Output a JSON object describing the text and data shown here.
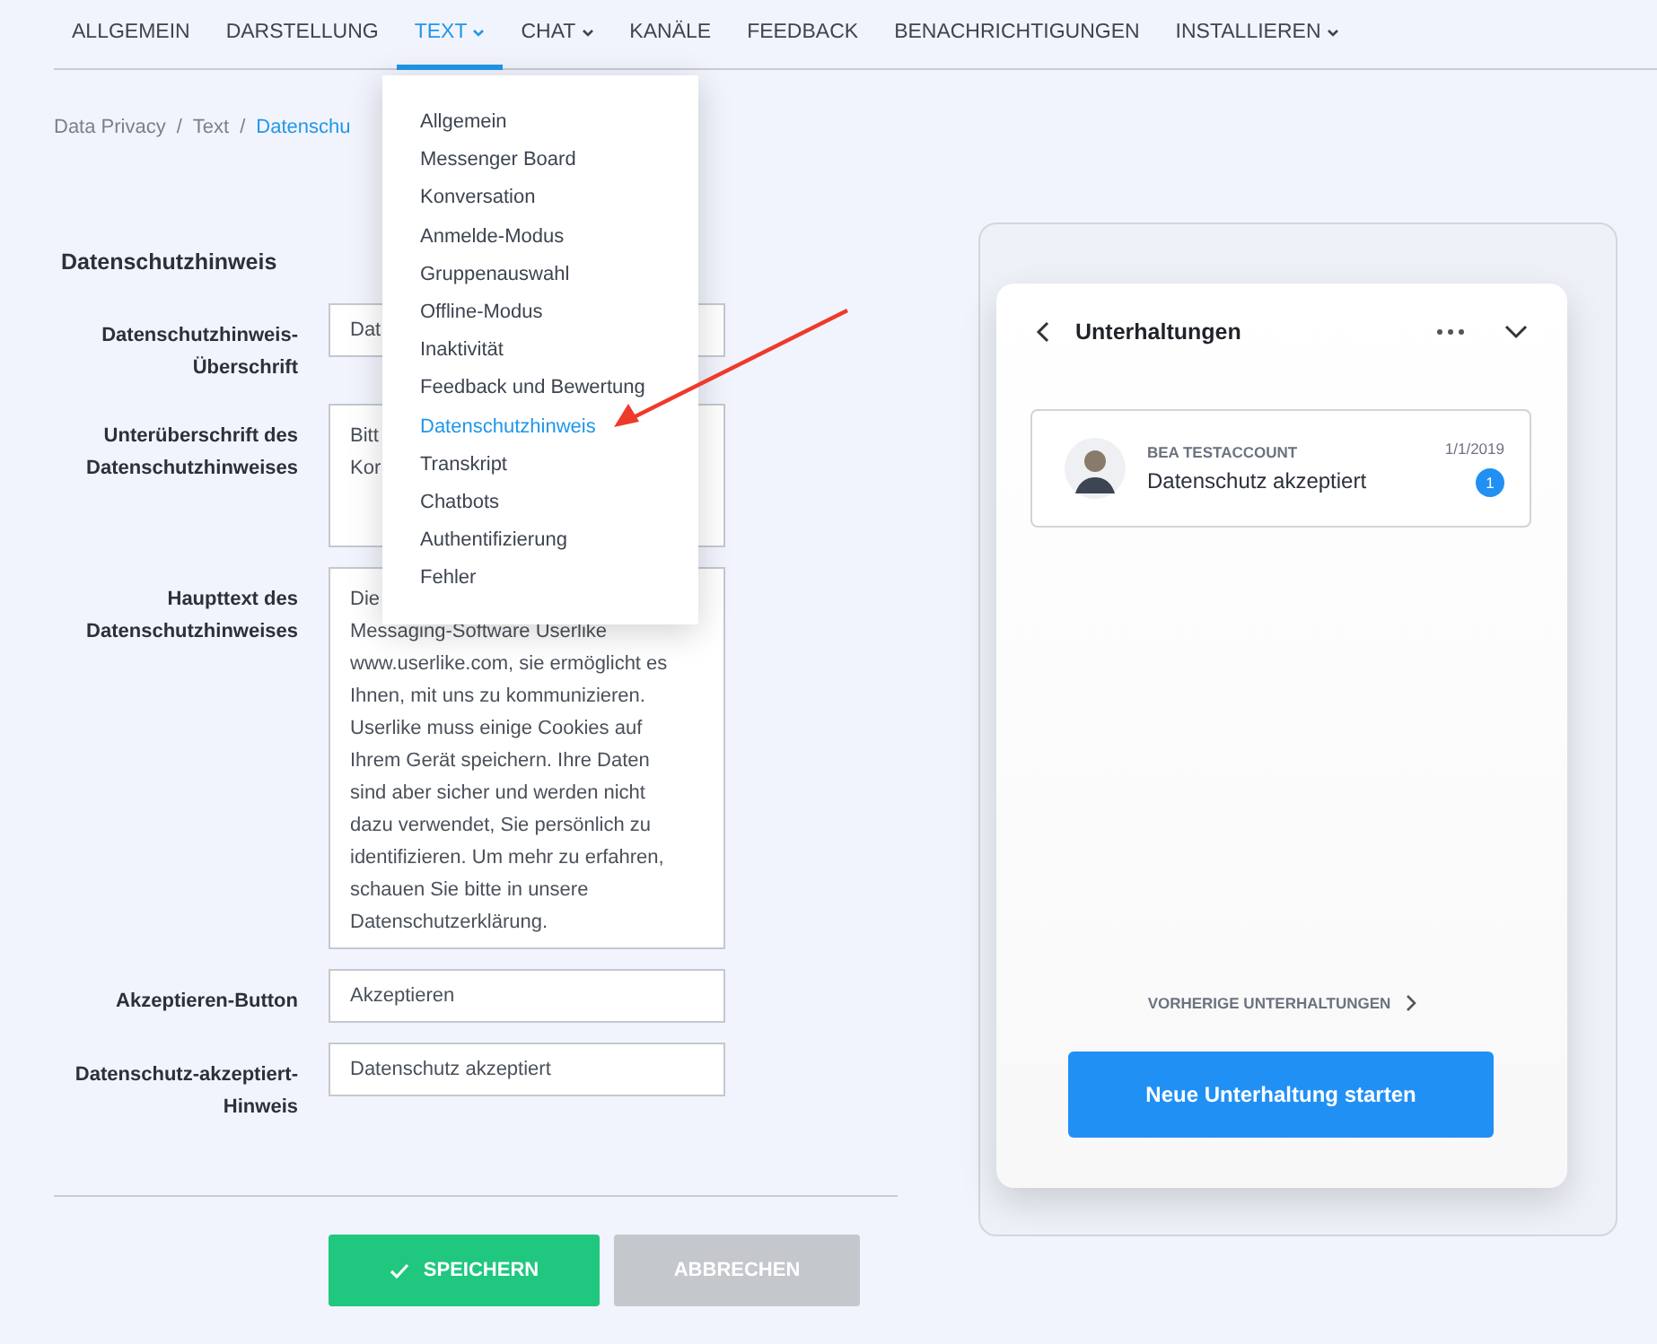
{
  "nav": {
    "items": [
      {
        "label": "ALLGEMEIN",
        "selected": false,
        "dropdown": false
      },
      {
        "label": "DARSTELLUNG",
        "selected": false,
        "dropdown": false
      },
      {
        "label": "TEXT",
        "selected": true,
        "dropdown": true
      },
      {
        "label": "CHAT",
        "selected": false,
        "dropdown": true
      },
      {
        "label": "KANÄLE",
        "selected": false,
        "dropdown": false
      },
      {
        "label": "FEEDBACK",
        "selected": false,
        "dropdown": false
      },
      {
        "label": "BENACHRICHTIGUNGEN",
        "selected": false,
        "dropdown": false
      },
      {
        "label": "INSTALLIEREN",
        "selected": false,
        "dropdown": true
      }
    ]
  },
  "breadcrumb": {
    "items": [
      "Data Privacy",
      "Text",
      "Datenschu"
    ],
    "separators": [
      "/",
      "/"
    ]
  },
  "dropdown_menu": {
    "items": [
      {
        "label": "Allgemein",
        "selected": false
      },
      {
        "label": "Messenger Board",
        "selected": false
      },
      {
        "label": "Konversation",
        "selected": false
      },
      {
        "label": "Anmelde-Modus",
        "selected": false
      },
      {
        "label": "Gruppenauswahl",
        "selected": false
      },
      {
        "label": "Offline-Modus",
        "selected": false
      },
      {
        "label": "Inaktivität",
        "selected": false
      },
      {
        "label": "Feedback und Bewertung",
        "selected": false
      },
      {
        "label": "Datenschutzhinweis",
        "selected": true
      },
      {
        "label": "Transkript",
        "selected": false
      },
      {
        "label": "Chatbots",
        "selected": false
      },
      {
        "label": "Authentifizierung",
        "selected": false
      },
      {
        "label": "Fehler",
        "selected": false
      }
    ]
  },
  "form": {
    "title": "Datenschutzhinweis",
    "fields": [
      {
        "label": [
          "Datenschutzhinweis-",
          "Überschrift"
        ],
        "kind": "single",
        "lines": [
          "Dat"
        ]
      },
      {
        "label": [
          "Unterüberschrift des",
          "Datenschutzhinweises"
        ],
        "kind": "medium",
        "lines": [
          "Bitt",
          "Kor"
        ]
      },
      {
        "label": [
          "Haupttext des",
          "Datenschutzhinweises"
        ],
        "kind": "large",
        "lines": [
          "Die",
          "Messaging-Software Userlike",
          "www.userlike.com, sie ermöglicht es",
          "Ihnen, mit uns zu kommunizieren.",
          "Userlike muss einige Cookies auf",
          "Ihrem Gerät speichern. Ihre Daten",
          "sind aber sicher und werden nicht",
          "dazu verwendet, Sie persönlich zu",
          "identifizieren. Um mehr zu erfahren,",
          "schauen Sie bitte in unsere",
          "Datenschutzerklärung."
        ]
      },
      {
        "label": [
          "Akzeptieren-Button"
        ],
        "kind": "single",
        "lines": [
          "Akzeptieren"
        ]
      },
      {
        "label": [
          "Datenschutz-akzeptiert-",
          "Hinweis"
        ],
        "kind": "single",
        "lines": [
          "Datenschutz akzeptiert"
        ]
      }
    ]
  },
  "buttons": [
    {
      "label": "SPEICHERN",
      "disabled": false
    },
    {
      "label": "ABBRECHEN",
      "disabled": true
    }
  ],
  "preview": {
    "title": "Unterhaltungen",
    "conversation": {
      "name": "BEA TESTACCOUNT",
      "date": "1/1/2019",
      "message": "Datenschutz akzeptiert",
      "unread": "1"
    },
    "previous_link": "VORHERIGE UNTERHALTUNGEN",
    "start_button": "Neue Unterhaltung starten"
  }
}
